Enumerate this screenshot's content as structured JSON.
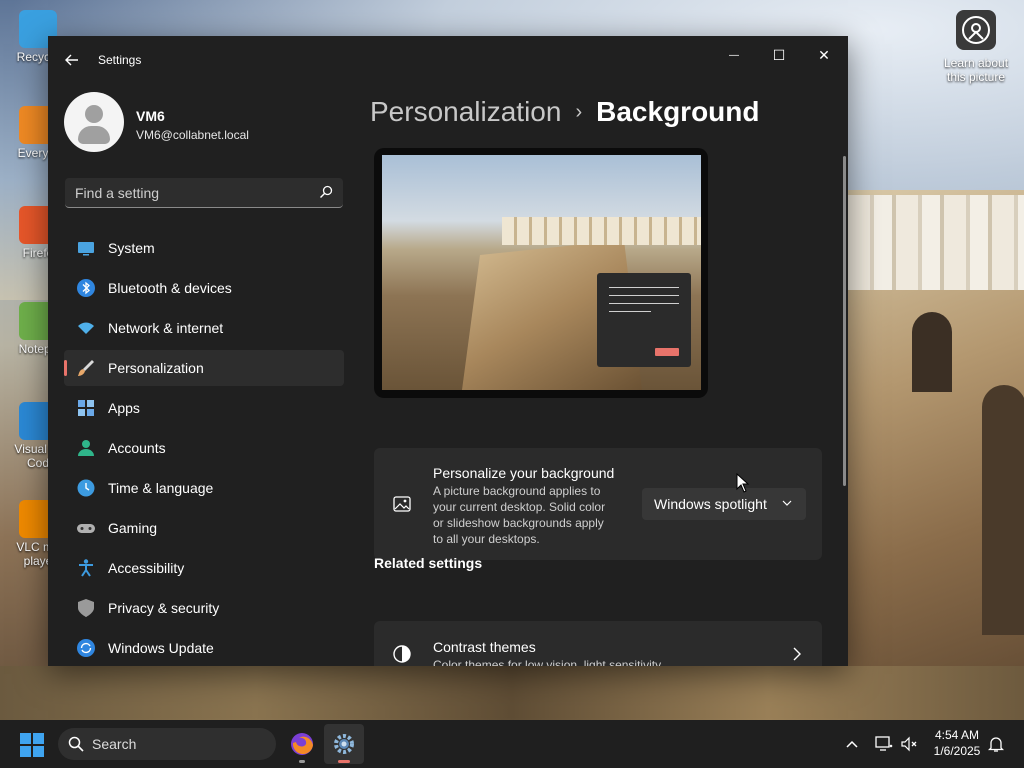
{
  "window": {
    "app_title": "Settings",
    "minimize_glyph": "—",
    "maximize_glyph": "☐",
    "close_glyph": "✕"
  },
  "desktop": {
    "icons": [
      {
        "label": "Recycle",
        "icon": "recycle-bin-icon",
        "color": "#3aa0e0"
      },
      {
        "label": "Everyth",
        "icon": "everything-search-icon",
        "color": "#f08a24"
      },
      {
        "label": "Firefo",
        "icon": "firefox-icon",
        "color": "#e8572a"
      },
      {
        "label": "Notepa",
        "icon": "notepad-icon",
        "color": "#6fb04b"
      },
      {
        "label": "Visual St Cod",
        "icon": "vscode-icon",
        "color": "#2b89d6"
      },
      {
        "label": "VLC me playe",
        "icon": "vlc-icon",
        "color": "#f08a00"
      }
    ],
    "learn_about": "Learn about this picture"
  },
  "profile": {
    "name": "VM6",
    "email": "VM6@collabnet.local"
  },
  "search": {
    "placeholder": "Find a setting"
  },
  "nav": {
    "items": [
      {
        "label": "System",
        "icon": "system-display-icon",
        "color": "#4aa3e0"
      },
      {
        "label": "Bluetooth & devices",
        "icon": "bluetooth-icon",
        "color": "#2f86e0"
      },
      {
        "label": "Network & internet",
        "icon": "wifi-icon",
        "color": "#4fb0ea"
      },
      {
        "label": "Personalization",
        "icon": "paintbrush-icon",
        "color": "#e8a86a"
      },
      {
        "label": "Apps",
        "icon": "apps-icon",
        "color": "#6aa8e8"
      },
      {
        "label": "Accounts",
        "icon": "accounts-icon",
        "color": "#2fb58a"
      },
      {
        "label": "Time & language",
        "icon": "globe-clock-icon",
        "color": "#3d9be0"
      },
      {
        "label": "Gaming",
        "icon": "gamepad-icon",
        "color": "#b0b0b0"
      },
      {
        "label": "Accessibility",
        "icon": "accessibility-icon",
        "color": "#3d9be0"
      },
      {
        "label": "Privacy & security",
        "icon": "shield-icon",
        "color": "#9a9a9a"
      },
      {
        "label": "Windows Update",
        "icon": "windows-update-icon",
        "color": "#2f86e0"
      }
    ],
    "active_index": 3
  },
  "breadcrumb": {
    "parent": "Personalization",
    "separator": "›",
    "current": "Background"
  },
  "background_card": {
    "title": "Personalize your background",
    "description_lines": [
      "A picture background applies to",
      "your current desktop. Solid color",
      "or slideshow backgrounds apply",
      "to all your desktops."
    ],
    "dropdown_value": "Windows spotlight"
  },
  "related": {
    "heading": "Related settings",
    "contrast_title": "Contrast themes",
    "contrast_desc": "Color themes for low vision, light sensitivity"
  },
  "taskbar": {
    "search_label": "Search",
    "time": "4:54 AM",
    "date": "1/6/2025"
  },
  "colors": {
    "accent": "#e8736a",
    "window_bg": "#202020",
    "card_bg": "#2b2b2b"
  }
}
